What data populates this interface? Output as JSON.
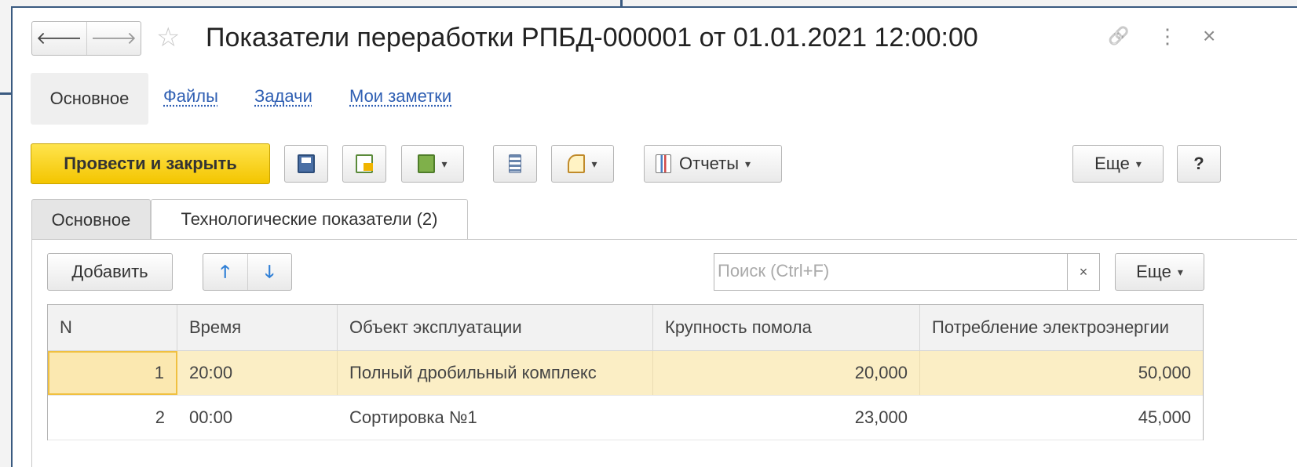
{
  "window": {
    "title": "Показатели переработки РПБД-000001 от 01.01.2021 12:00:00",
    "back_glyph": "🡐",
    "forward_glyph": "🡒",
    "star_glyph": "☆",
    "link_glyph": "🔗",
    "more_glyph": "⋮",
    "close_glyph": "×"
  },
  "form_nav": {
    "active": "Основное",
    "links": [
      "Файлы",
      "Задачи",
      "Мои заметки"
    ]
  },
  "toolbar": {
    "post_close": "Провести и закрыть",
    "reports": "Отчеты",
    "more": "Еще",
    "help": "?",
    "caret": "▾"
  },
  "page_tabs": [
    "Основное",
    "Технологические показатели (2)"
  ],
  "table_toolbar": {
    "add": "Добавить",
    "up_glyph": "🡑",
    "down_glyph": "🡓",
    "search_placeholder": "Поиск (Ctrl+F)",
    "search_clear": "×",
    "more": "Еще"
  },
  "table": {
    "columns": [
      "N",
      "Время",
      "Объект эксплуатации",
      "Крупность помола",
      "Потребление электроэнергии"
    ],
    "rows": [
      [
        "1",
        "20:00",
        "Полный дробильный комплекс",
        "20,000",
        "50,000"
      ],
      [
        "2",
        "00:00",
        "Сортировка №1",
        "23,000",
        "45,000"
      ]
    ]
  },
  "colors": {
    "accent_yellow": "#f3c500",
    "link_blue": "#2f5fb3",
    "selected_row": "#fbeec5",
    "frame_blue": "#3a5a80"
  }
}
